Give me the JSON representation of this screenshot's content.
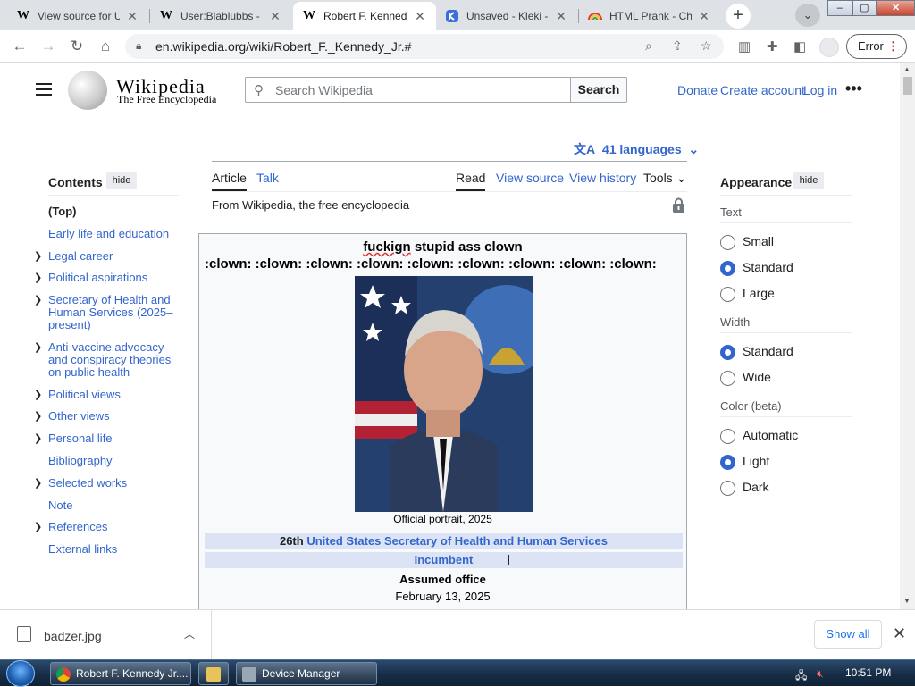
{
  "browser": {
    "tabs": [
      {
        "label": "View source for U",
        "favicon": "W",
        "active": false
      },
      {
        "label": "User:Blablubbs - W",
        "favicon": "W",
        "active": false
      },
      {
        "label": "Robert F. Kenned",
        "favicon": "W",
        "active": true
      },
      {
        "label": "Unsaved - Kleki - I",
        "favicon": "kleki-icon",
        "active": false
      },
      {
        "label": "HTML Prank - Chr",
        "favicon": "rainbow-icon",
        "active": false
      }
    ],
    "new_tab": "+",
    "url": "en.wikipedia.org/wiki/Robert_F._Kennedy_Jr.#",
    "error_label": "Error"
  },
  "wiki": {
    "wordmark": "Wikipedia",
    "tagline": "The Free Encyclopedia",
    "search_placeholder": "Search Wikipedia",
    "search_button": "Search",
    "donate": "Donate",
    "create_account": "Create account",
    "log_in": "Log in",
    "languages": "41 languages",
    "tabs": {
      "article": "Article",
      "talk": "Talk",
      "read": "Read",
      "view_source": "View source",
      "view_history": "View history",
      "tools": "Tools"
    },
    "from_wikipedia": "From Wikipedia, the free encyclopedia"
  },
  "toc": {
    "heading": "Contents",
    "hide": "hide",
    "items": [
      {
        "label": "(Top)",
        "expandable": false
      },
      {
        "label": "Early life and education",
        "expandable": false
      },
      {
        "label": "Legal career",
        "expandable": true
      },
      {
        "label": "Political aspirations",
        "expandable": true
      },
      {
        "label": "Secretary of Health and Human Services (2025–present)",
        "expandable": true
      },
      {
        "label": "Anti-vaccine advocacy and conspiracy theories on public health",
        "expandable": true
      },
      {
        "label": "Political views",
        "expandable": true
      },
      {
        "label": "Other views",
        "expandable": true
      },
      {
        "label": "Personal life",
        "expandable": true
      },
      {
        "label": "Bibliography",
        "expandable": false
      },
      {
        "label": "Selected works",
        "expandable": true
      },
      {
        "label": "Note",
        "expandable": false
      },
      {
        "label": "References",
        "expandable": true
      },
      {
        "label": "External links",
        "expandable": false
      }
    ]
  },
  "infobox": {
    "title_misspelled": "fuckign",
    "title_rest": " stupid ass clown",
    "clowns": ":clown: :clown: :clown: :clown: :clown: :clown: :clown: :clown: :clown:",
    "caption": "Official portrait, 2025",
    "ordinal": "26th",
    "office": "United States Secretary of Health and Human Services",
    "status": "Incumbent",
    "assumed": "Assumed office",
    "date": "February 13, 2025"
  },
  "appearance": {
    "heading": "Appearance",
    "hide": "hide",
    "text_label": "Text",
    "text_options": [
      "Small",
      "Standard",
      "Large"
    ],
    "text_selected": "Standard",
    "width_label": "Width",
    "width_options": [
      "Standard",
      "Wide"
    ],
    "width_selected": "Standard",
    "color_label": "Color (beta)",
    "color_options": [
      "Automatic",
      "Light",
      "Dark"
    ],
    "color_selected": "Light"
  },
  "download": {
    "filename": "badzer.jpg",
    "show_all": "Show all"
  },
  "taskbar": {
    "buttons": [
      {
        "label": "Robert F. Kennedy Jr...."
      },
      {
        "label": "Device Manager"
      }
    ],
    "clock": "10:51 PM"
  },
  "colors": {
    "link": "#3366cc",
    "chrome_bg": "#dee1e6",
    "infobox_band": "#dbe3f5"
  }
}
